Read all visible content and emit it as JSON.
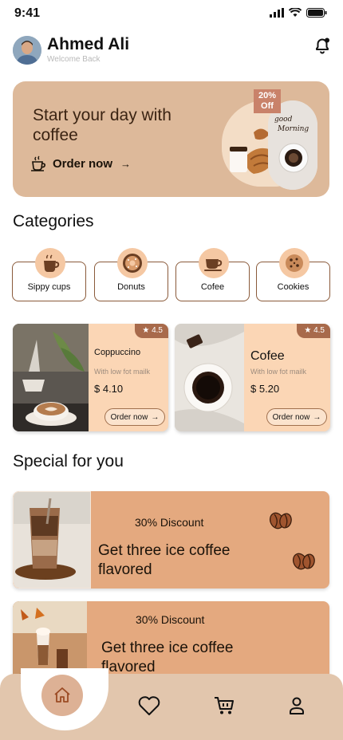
{
  "status_bar": {
    "time": "9:41"
  },
  "header": {
    "user_name": "Ahmed Ali",
    "welcome": "Welcome Back"
  },
  "hero": {
    "title": "Start your day with coffee",
    "order_label": "Order now",
    "promo_line1": "20%",
    "promo_line2": "Off",
    "photo_caption_1": "good",
    "photo_caption_2": "Morning"
  },
  "categories": {
    "title": "Categories",
    "items": [
      {
        "label": "Sippy cups",
        "icon": "cup-icon"
      },
      {
        "label": "Donuts",
        "icon": "donut-icon"
      },
      {
        "label": "Cofee",
        "icon": "coffee-cup-icon"
      },
      {
        "label": "Cookies",
        "icon": "cookie-icon"
      }
    ]
  },
  "products": [
    {
      "name": "Coppuccino",
      "description": "With low fot mailk",
      "price": "$ 4.10",
      "rating": "4.5",
      "button": "Order now"
    },
    {
      "name": "Cofee",
      "description": "With low fot mailk",
      "price": "$ 5.20",
      "rating": "4.5",
      "button": "Order now"
    }
  ],
  "special": {
    "title": "Special for you",
    "cards": [
      {
        "discount": "30% Discount",
        "headline": "Get three ice coffee flavored"
      },
      {
        "discount": "30% Discount",
        "headline": "Get three ice coffee flavored"
      }
    ]
  },
  "nav": {
    "items": [
      "home-icon",
      "heart-icon",
      "cart-icon",
      "profile-icon"
    ]
  },
  "colors": {
    "accent": "#ddb99a",
    "card": "#fbd6b5",
    "special": "#e4a97f",
    "brown": "#a86a4b"
  }
}
